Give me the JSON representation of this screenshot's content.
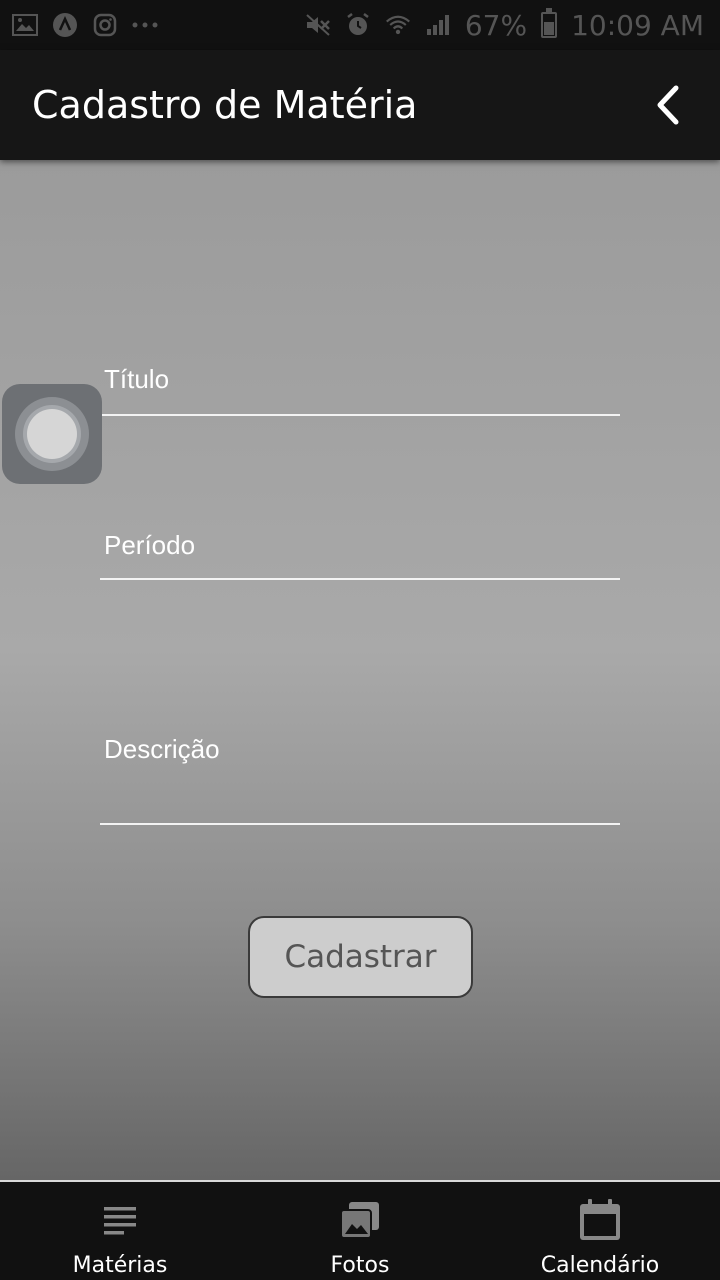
{
  "status_bar": {
    "icons_left": [
      "gallery-icon",
      "app-icon",
      "instagram-icon",
      "more-icon"
    ],
    "icons_right": [
      "mute-icon",
      "alarm-icon",
      "wifi-icon",
      "signal-icon"
    ],
    "battery_percent": "67%",
    "time": "10:09 AM"
  },
  "app_bar": {
    "title": "Cadastro de Matéria",
    "back_icon": "chevron-left-icon"
  },
  "form": {
    "fields": [
      {
        "label": "Título"
      },
      {
        "label": "Período"
      },
      {
        "label": "Descrição"
      }
    ],
    "submit_label": "Cadastrar"
  },
  "bottom_nav": {
    "items": [
      {
        "label": "Matérias",
        "icon": "list-icon"
      },
      {
        "label": "Fotos",
        "icon": "photos-icon"
      },
      {
        "label": "Calendário",
        "icon": "calendar-icon"
      }
    ]
  }
}
